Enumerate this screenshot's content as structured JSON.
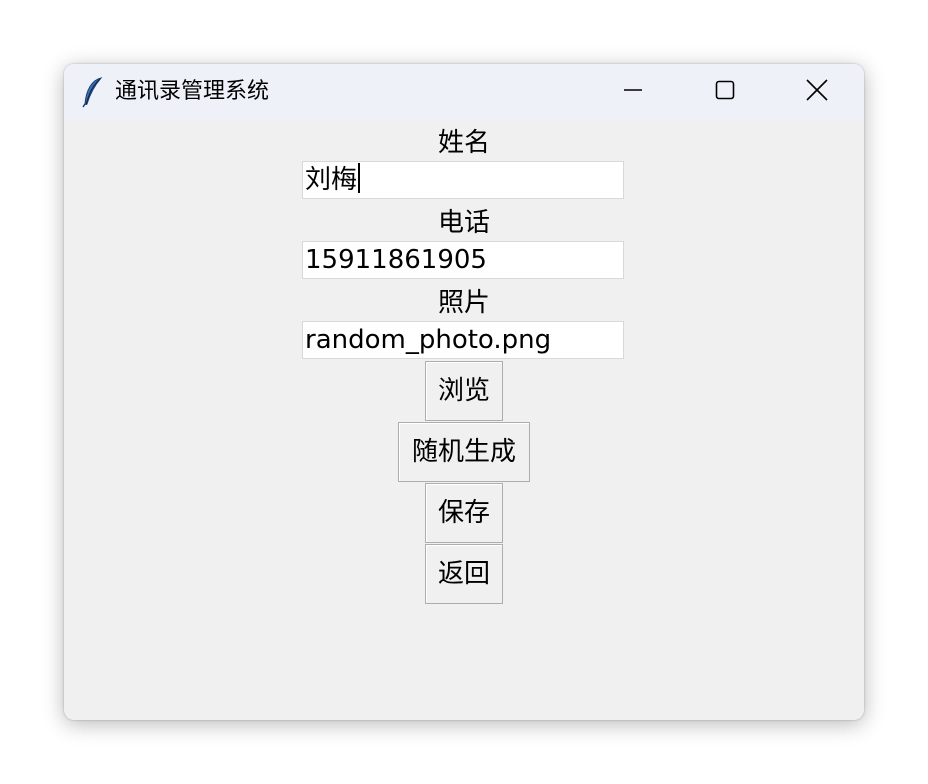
{
  "window": {
    "title": "通讯录管理系统",
    "icon": "feather-icon",
    "controls": [
      "minimize-icon",
      "maximize-icon",
      "close-icon"
    ]
  },
  "form": {
    "name_label": "姓名",
    "name_value": "刘梅",
    "phone_label": "电话",
    "phone_value": "15911861905",
    "photo_label": "照片",
    "photo_value": "random_photo.png"
  },
  "buttons": {
    "browse": "浏览",
    "random": "随机生成",
    "save": "保存",
    "back": "返回"
  }
}
